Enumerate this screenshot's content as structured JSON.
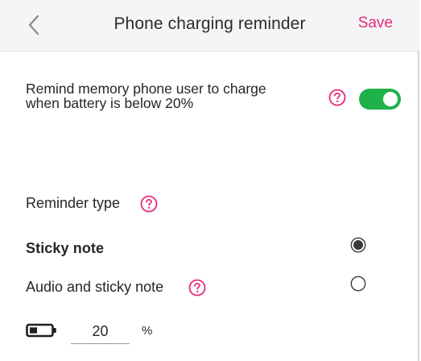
{
  "header": {
    "title": "Phone charging reminder",
    "save_label": "Save"
  },
  "reminder": {
    "description_line1": "Remind memory phone user to charge",
    "description_line2": "when battery is below 20%",
    "enabled": true
  },
  "reminder_type": {
    "label": "Reminder type",
    "options": [
      {
        "label": "Sticky note",
        "selected": true
      },
      {
        "label": "Audio and sticky note",
        "selected": false
      }
    ]
  },
  "battery_threshold": {
    "value": "20",
    "unit": "%"
  },
  "colors": {
    "accent": "#e8287a",
    "toggle_on": "#1fb24a",
    "header_bg": "#f5f5f5"
  },
  "icons": {
    "back": "chevron-left-icon",
    "help": "question-circle-icon",
    "battery": "battery-icon"
  }
}
